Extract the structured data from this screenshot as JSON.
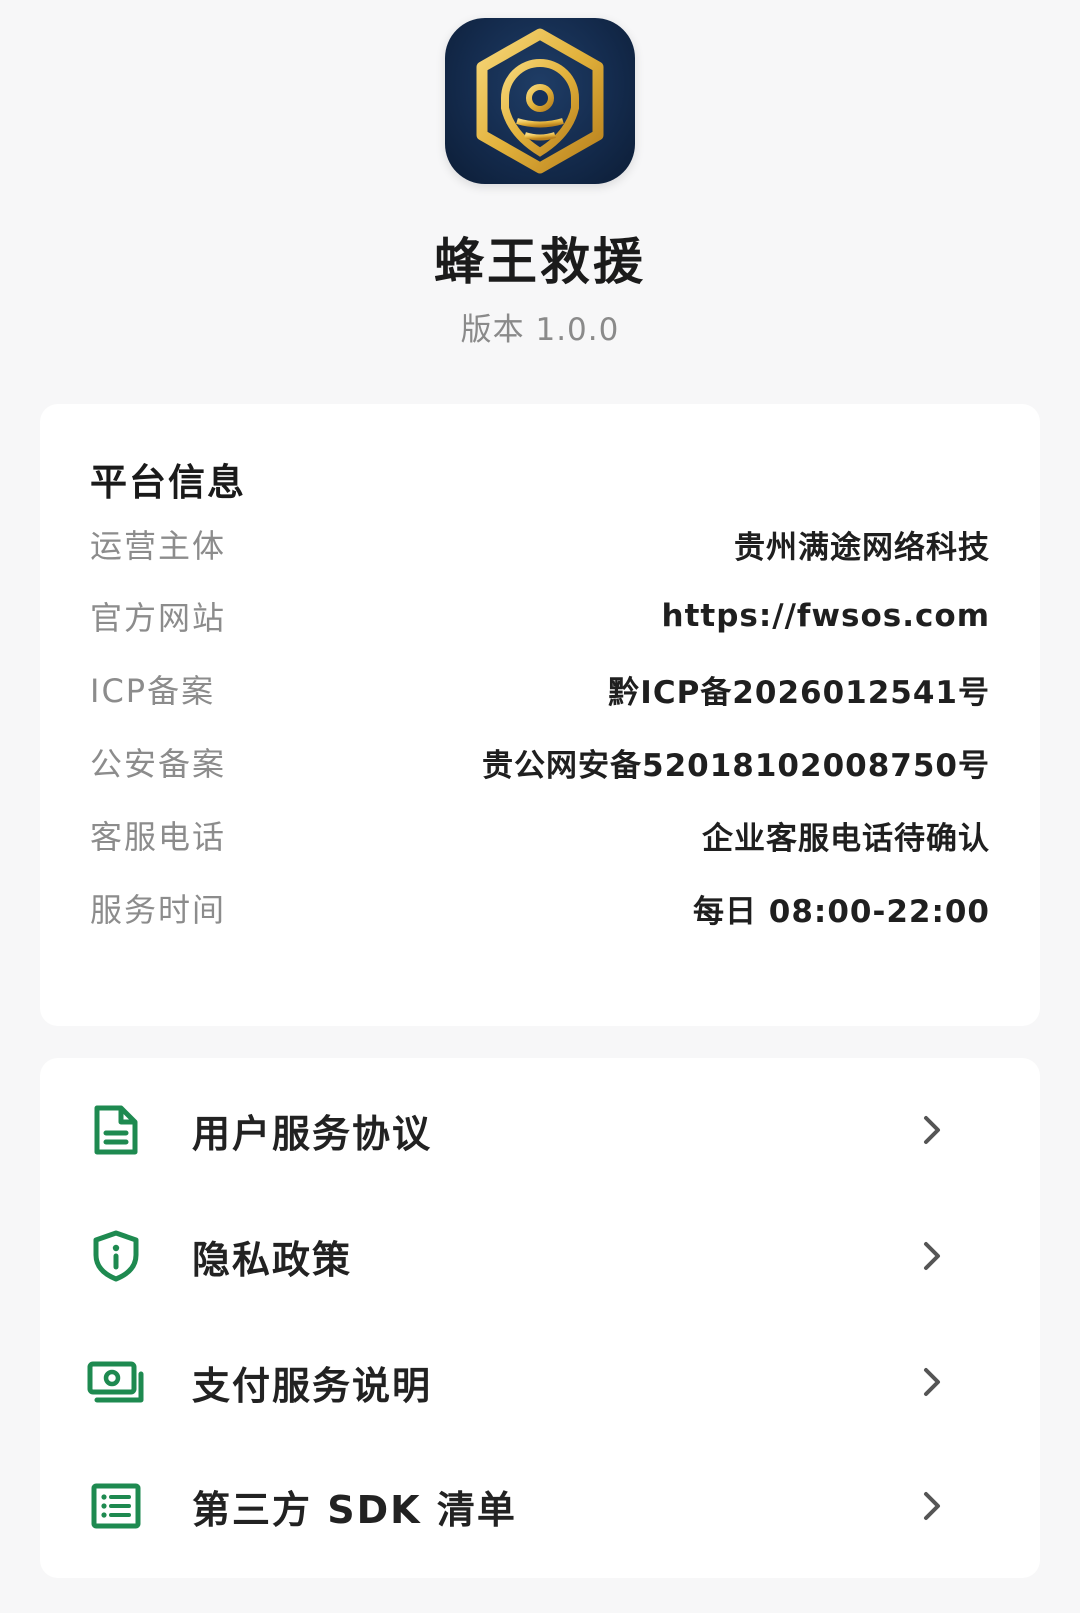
{
  "header": {
    "app_name": "蜂王救援",
    "version": "版本 1.0.0",
    "logo_icon": "bee-rescue-logo-icon"
  },
  "colors": {
    "accent_green": "#1e8a50",
    "logo_gold": "#e2b23c",
    "logo_background": "#15305a"
  },
  "platform_info": {
    "title": "平台信息",
    "rows": [
      {
        "label": "运营主体",
        "value": "贵州满途网络科技"
      },
      {
        "label": "官方网站",
        "value": "https://fwsos.com"
      },
      {
        "label": "ICP备案",
        "value": "黔ICP备2026012541号"
      },
      {
        "label": "公安备案",
        "value": "贵公网安备52018102008750号"
      },
      {
        "label": "客服电话",
        "value": "企业客服电话待确认"
      },
      {
        "label": "服务时间",
        "value": "每日 08:00-22:00"
      }
    ]
  },
  "menu": {
    "items": [
      {
        "label": "用户服务协议",
        "icon": "document-icon"
      },
      {
        "label": "隐私政策",
        "icon": "shield-info-icon"
      },
      {
        "label": "支付服务说明",
        "icon": "money-icon"
      },
      {
        "label": "第三方 SDK 清单",
        "icon": "list-icon"
      }
    ]
  }
}
